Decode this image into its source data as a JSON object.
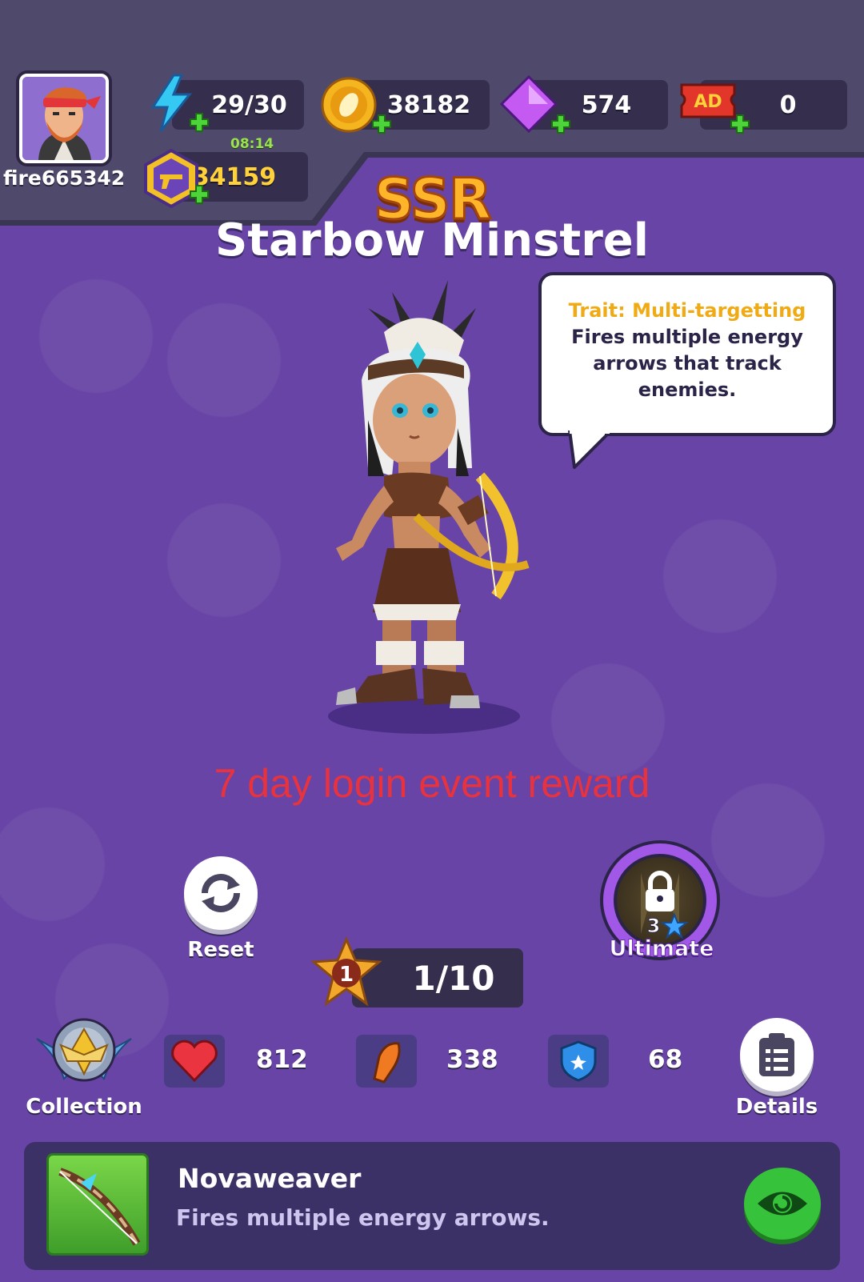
{
  "player": {
    "username": "fire665342"
  },
  "currencies": {
    "energy": {
      "value": "29/30",
      "timer": "08:14",
      "icon": "lightning-icon"
    },
    "coins": {
      "value": "38182",
      "icon": "coin-icon"
    },
    "gems": {
      "value": "574",
      "icon": "gem-icon"
    },
    "ad_tickets": {
      "value": "0",
      "icon": "ad-ticket-icon",
      "badge": "AD"
    },
    "gun_tokens": {
      "value": "34159",
      "icon": "gun-token-icon"
    }
  },
  "hero": {
    "rarity": "SSR",
    "name": "Starbow Minstrel",
    "trait_title": "Trait: Multi-targetting",
    "trait_text": "Fires multiple energy arrows that track enemies.",
    "event_text": "7 day login event reward"
  },
  "actions": {
    "reset_label": "Reset",
    "ultimate_label": "Ultimate",
    "ultimate_stars": "3",
    "collection_label": "Collection",
    "details_label": "Details"
  },
  "level": {
    "badge": "1",
    "progress": "1/10"
  },
  "stats": {
    "hp": "812",
    "attack": "338",
    "defense": "68"
  },
  "skill": {
    "name": "Novaweaver",
    "description": "Fires multiple energy arrows."
  },
  "colors": {
    "background": "#6744a6",
    "accent_gold": "#f0aa14",
    "event_red": "#e8333f",
    "ultimate_purple": "#a158e6",
    "eye_green": "#36c23a"
  }
}
